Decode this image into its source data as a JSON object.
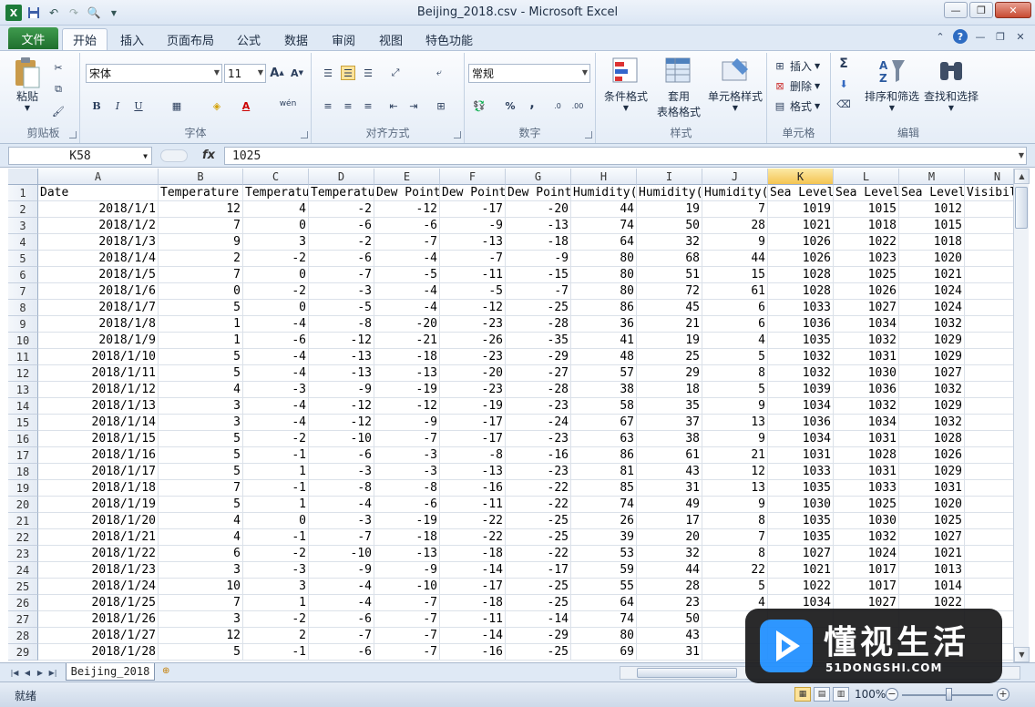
{
  "window": {
    "title": "Beijing_2018.csv - Microsoft Excel",
    "icons": [
      "excel-icon",
      "save-icon",
      "undo-icon",
      "redo-icon",
      "print-preview-icon"
    ]
  },
  "tabs": {
    "file": "文件",
    "items": [
      "开始",
      "插入",
      "页面布局",
      "公式",
      "数据",
      "审阅",
      "视图",
      "特色功能"
    ],
    "active": "开始"
  },
  "ribbon": {
    "clipboard": {
      "label": "剪贴板",
      "paste": "粘贴"
    },
    "font": {
      "label": "字体",
      "name": "宋体",
      "size": "11",
      "bold": "B",
      "italic": "I",
      "underline": "U",
      "ww": "wén"
    },
    "alignment": {
      "label": "对齐方式"
    },
    "number": {
      "label": "数字",
      "format": "常规",
      "percent": "%",
      "comma": ",",
      "inc": ".0",
      "dec": ".00"
    },
    "styles": {
      "label": "样式",
      "conditional": "条件格式",
      "table_line1": "套用",
      "table_line2": "表格格式",
      "cell_styles": "单元格样式"
    },
    "cells": {
      "label": "单元格",
      "insert": "插入",
      "delete": "删除",
      "format": "格式"
    },
    "editing": {
      "label": "编辑",
      "sum": "Σ",
      "sort": "排序和筛选",
      "find": "查找和选择"
    }
  },
  "formula_bar": {
    "name_box": "K58",
    "fx": "fx",
    "value": "1025"
  },
  "grid": {
    "columns": [
      "A",
      "B",
      "C",
      "D",
      "E",
      "F",
      "G",
      "H",
      "I",
      "J",
      "K",
      "L",
      "M",
      "N"
    ],
    "selected_column": "K",
    "header_row": [
      "Date",
      "Temperature",
      "Temperature",
      "Temperature",
      "Dew Point",
      "Dew Point",
      "Dew Point",
      "Humidity(",
      "Humidity(",
      "Humidity(",
      "Sea Level",
      "Sea Level",
      "Sea Level",
      "Visibility"
    ],
    "rows": [
      [
        "2018/1/1",
        "12",
        "4",
        "-2",
        "-12",
        "-17",
        "-20",
        "44",
        "19",
        "7",
        "1019",
        "1015",
        "1012"
      ],
      [
        "2018/1/2",
        "7",
        "0",
        "-6",
        "-6",
        "-9",
        "-13",
        "74",
        "50",
        "28",
        "1021",
        "1018",
        "1015"
      ],
      [
        "2018/1/3",
        "9",
        "3",
        "-2",
        "-7",
        "-13",
        "-18",
        "64",
        "32",
        "9",
        "1026",
        "1022",
        "1018"
      ],
      [
        "2018/1/4",
        "2",
        "-2",
        "-6",
        "-4",
        "-7",
        "-9",
        "80",
        "68",
        "44",
        "1026",
        "1023",
        "1020"
      ],
      [
        "2018/1/5",
        "7",
        "0",
        "-7",
        "-5",
        "-11",
        "-15",
        "80",
        "51",
        "15",
        "1028",
        "1025",
        "1021"
      ],
      [
        "2018/1/6",
        "0",
        "-2",
        "-3",
        "-4",
        "-5",
        "-7",
        "80",
        "72",
        "61",
        "1028",
        "1026",
        "1024"
      ],
      [
        "2018/1/7",
        "5",
        "0",
        "-5",
        "-4",
        "-12",
        "-25",
        "86",
        "45",
        "6",
        "1033",
        "1027",
        "1024"
      ],
      [
        "2018/1/8",
        "1",
        "-4",
        "-8",
        "-20",
        "-23",
        "-28",
        "36",
        "21",
        "6",
        "1036",
        "1034",
        "1032"
      ],
      [
        "2018/1/9",
        "1",
        "-6",
        "-12",
        "-21",
        "-26",
        "-35",
        "41",
        "19",
        "4",
        "1035",
        "1032",
        "1029"
      ],
      [
        "2018/1/10",
        "5",
        "-4",
        "-13",
        "-18",
        "-23",
        "-29",
        "48",
        "25",
        "5",
        "1032",
        "1031",
        "1029"
      ],
      [
        "2018/1/11",
        "5",
        "-4",
        "-13",
        "-13",
        "-20",
        "-27",
        "57",
        "29",
        "8",
        "1032",
        "1030",
        "1027"
      ],
      [
        "2018/1/12",
        "4",
        "-3",
        "-9",
        "-19",
        "-23",
        "-28",
        "38",
        "18",
        "5",
        "1039",
        "1036",
        "1032"
      ],
      [
        "2018/1/13",
        "3",
        "-4",
        "-12",
        "-12",
        "-19",
        "-23",
        "58",
        "35",
        "9",
        "1034",
        "1032",
        "1029"
      ],
      [
        "2018/1/14",
        "3",
        "-4",
        "-12",
        "-9",
        "-17",
        "-24",
        "67",
        "37",
        "13",
        "1036",
        "1034",
        "1032"
      ],
      [
        "2018/1/15",
        "5",
        "-2",
        "-10",
        "-7",
        "-17",
        "-23",
        "63",
        "38",
        "9",
        "1034",
        "1031",
        "1028"
      ],
      [
        "2018/1/16",
        "5",
        "-1",
        "-6",
        "-3",
        "-8",
        "-16",
        "86",
        "61",
        "21",
        "1031",
        "1028",
        "1026"
      ],
      [
        "2018/1/17",
        "5",
        "1",
        "-3",
        "-3",
        "-13",
        "-23",
        "81",
        "43",
        "12",
        "1033",
        "1031",
        "1029"
      ],
      [
        "2018/1/18",
        "7",
        "-1",
        "-8",
        "-8",
        "-16",
        "-22",
        "85",
        "31",
        "13",
        "1035",
        "1033",
        "1031"
      ],
      [
        "2018/1/19",
        "5",
        "1",
        "-4",
        "-6",
        "-11",
        "-22",
        "74",
        "49",
        "9",
        "1030",
        "1025",
        "1020"
      ],
      [
        "2018/1/20",
        "4",
        "0",
        "-3",
        "-19",
        "-22",
        "-25",
        "26",
        "17",
        "8",
        "1035",
        "1030",
        "1025"
      ],
      [
        "2018/1/21",
        "4",
        "-1",
        "-7",
        "-18",
        "-22",
        "-25",
        "39",
        "20",
        "7",
        "1035",
        "1032",
        "1027"
      ],
      [
        "2018/1/22",
        "6",
        "-2",
        "-10",
        "-13",
        "-18",
        "-22",
        "53",
        "32",
        "8",
        "1027",
        "1024",
        "1021"
      ],
      [
        "2018/1/23",
        "3",
        "-3",
        "-9",
        "-9",
        "-14",
        "-17",
        "59",
        "44",
        "22",
        "1021",
        "1017",
        "1013"
      ],
      [
        "2018/1/24",
        "10",
        "3",
        "-4",
        "-10",
        "-17",
        "-25",
        "55",
        "28",
        "5",
        "1022",
        "1017",
        "1014"
      ],
      [
        "2018/1/25",
        "7",
        "1",
        "-4",
        "-7",
        "-18",
        "-25",
        "64",
        "23",
        "4",
        "1034",
        "1027",
        "1022"
      ],
      [
        "2018/1/26",
        "3",
        "-2",
        "-6",
        "-7",
        "-11",
        "-14",
        "74",
        "50",
        "",
        "",
        "",
        ""
      ],
      [
        "2018/1/27",
        "12",
        "2",
        "-7",
        "-7",
        "-14",
        "-29",
        "80",
        "43",
        "",
        "",
        "",
        ""
      ],
      [
        "2018/1/28",
        "5",
        "-1",
        "-6",
        "-7",
        "-16",
        "-25",
        "69",
        "31",
        "",
        "",
        "",
        ""
      ]
    ]
  },
  "sheet": {
    "tab": "Beijing_2018"
  },
  "status": {
    "text": "就绪",
    "zoom": "100%",
    "zoom_percent": 100
  },
  "watermark": {
    "title": "懂视生活",
    "sub": "51DONGSHI.COM"
  },
  "colors": {
    "excel_green": "#1d7b3a",
    "selected_col": "#f4c452",
    "grid_line": "#dbe1e9",
    "watermark_blue": "#1f8fff"
  }
}
